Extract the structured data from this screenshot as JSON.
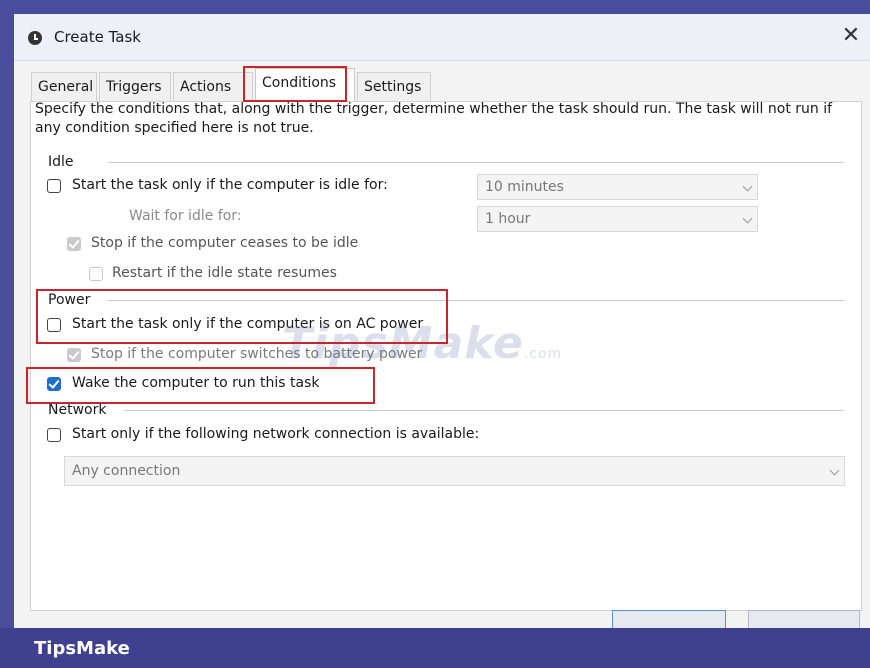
{
  "window": {
    "title": "Create Task",
    "close_glyph": "✕"
  },
  "tabs": [
    {
      "label": "General",
      "active": false
    },
    {
      "label": "Triggers",
      "active": false
    },
    {
      "label": "Actions",
      "active": false
    },
    {
      "label": "Conditions",
      "active": true
    },
    {
      "label": "Settings",
      "active": false
    }
  ],
  "description": "Specify the conditions that, along with the trigger, determine whether the task should run.  The task will not run  if any condition specified here is not true.",
  "idle": {
    "group_label": "Idle",
    "start_if_idle": {
      "label": "Start the task only if the computer is idle for:",
      "checked": false
    },
    "idle_for_value": "10 minutes",
    "wait_label": "Wait for idle for:",
    "wait_value": "1 hour",
    "stop_if_ceases": {
      "label": "Stop if the computer ceases to be idle",
      "checked": true,
      "enabled": false
    },
    "restart_if_resumes": {
      "label": "Restart if the idle state resumes",
      "checked": false,
      "enabled": false
    }
  },
  "power": {
    "group_label": "Power",
    "start_on_ac": {
      "label": "Start the task only if the computer is on AC power",
      "checked": false
    },
    "stop_on_battery": {
      "label": "Stop if the computer switches to battery power",
      "checked": true,
      "enabled": false
    },
    "wake_to_run": {
      "label": "Wake the computer to run this task",
      "checked": true
    }
  },
  "network": {
    "group_label": "Network",
    "start_if_network": {
      "label": "Start only if the following network connection is available:",
      "checked": false
    },
    "connection_value": "Any connection"
  },
  "watermark": {
    "main": "TipsMake",
    "suffix": ".com"
  },
  "footer": {
    "brand": "TipsMake"
  },
  "colors": {
    "accent": "#1c6ec7",
    "highlight": "#c8262d",
    "footer": "#3f418f"
  }
}
